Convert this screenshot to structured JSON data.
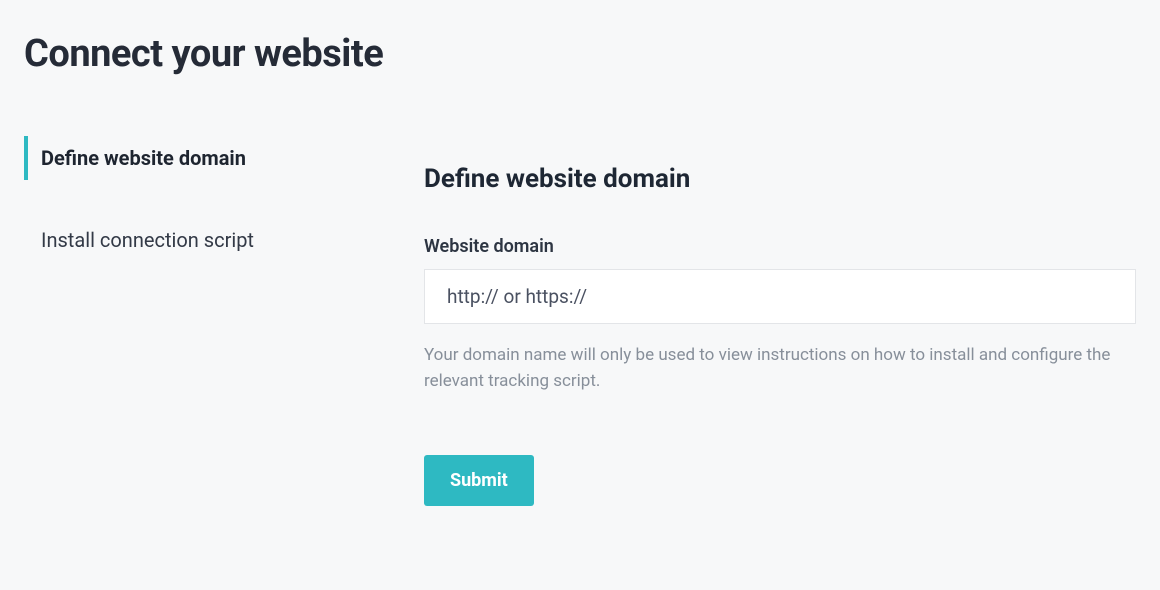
{
  "page": {
    "title": "Connect your website"
  },
  "sidebar": {
    "items": [
      {
        "label": "Define website domain",
        "active": true
      },
      {
        "label": "Install connection script",
        "active": false
      }
    ]
  },
  "main": {
    "heading": "Define website domain",
    "field_label": "Website domain",
    "domain_placeholder": "http:// or https://",
    "domain_value": "",
    "helper_text": "Your domain name will only be used to view instructions on how to install and configure the relevant tracking script.",
    "submit_label": "Submit"
  },
  "colors": {
    "accent": "#2eb9c2",
    "text_primary": "#252b37",
    "text_muted": "#878f9a",
    "background": "#f7f8f9"
  }
}
